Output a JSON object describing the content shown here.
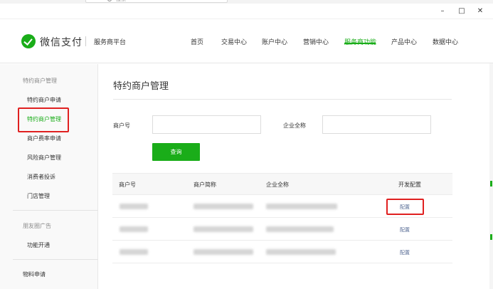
{
  "topbar": {
    "search_text": "搜索"
  },
  "window": {
    "minimize": "–",
    "maximize": "□",
    "close": "✕"
  },
  "header": {
    "brand": "微信支付",
    "sub": "服务商平台",
    "nav": [
      "首页",
      "交易中心",
      "账户中心",
      "营销中心",
      "服务商功能",
      "产品中心",
      "数据中心"
    ],
    "active_nav": "服务商功能"
  },
  "sidebar": {
    "group1": "特约商户管理",
    "items": [
      "特约商户申请",
      "特约商户管理",
      "商户费率申请",
      "风险商户管理",
      "消费者投诉",
      "门店管理"
    ],
    "active_item": "特约商户管理",
    "group2": "朋友圈广告",
    "items2": [
      "功能开通"
    ],
    "group3": "物料申请"
  },
  "main": {
    "title": "特约商户管理",
    "form": {
      "merchant_no_label": "商户号",
      "merchant_no_value": "",
      "company_label": "企业全称",
      "company_value": "",
      "query_button": "查询"
    },
    "table": {
      "headers": [
        "商户号",
        "商户简称",
        "企业全称",
        "开发配置"
      ],
      "rows": [
        {
          "config": "配置"
        },
        {
          "config": "配置"
        },
        {
          "config": "配置"
        }
      ]
    }
  },
  "colors": {
    "brand_green": "#1aad19",
    "link_blue": "#576b95",
    "highlight_red": "#e02020"
  }
}
